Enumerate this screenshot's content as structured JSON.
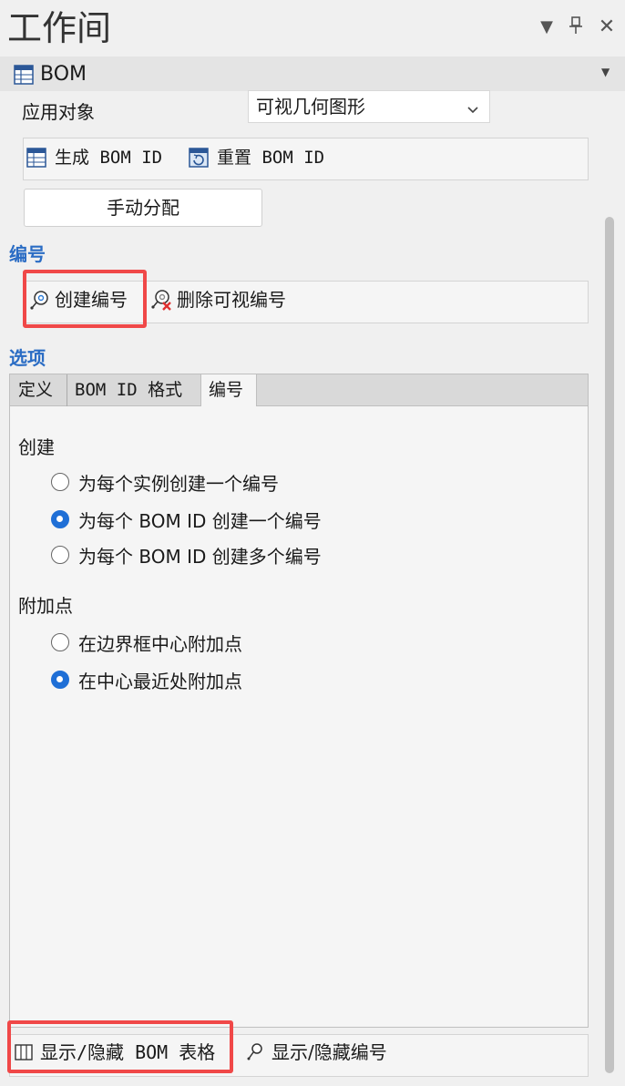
{
  "window": {
    "title": "工作间",
    "dropdown_icon": "triangle-down-icon",
    "pin_icon": "pin-icon",
    "close_icon": "close-icon"
  },
  "bom_section": {
    "label": "BOM",
    "icon": "table-icon",
    "apply_to": {
      "label": "应用对象",
      "selected": "可视几何图形"
    },
    "generate_strip": {
      "generate_label": "生成 BOM ID",
      "reset_label": "重置 BOM ID"
    },
    "manual_assign_label": "手动分配"
  },
  "numbering_section": {
    "title": "编号",
    "create_label": "创建编号",
    "delete_label": "删除可视编号"
  },
  "options_section": {
    "title": "选项",
    "tabs": [
      {
        "label": "定义",
        "active": false
      },
      {
        "label": "BOM ID 格式",
        "active": false
      },
      {
        "label": "编号",
        "active": true
      }
    ],
    "create_group": {
      "label": "创建",
      "options": [
        {
          "label": "为每个实例创建一个编号",
          "selected": false
        },
        {
          "label": "为每个 BOM ID 创建一个编号",
          "selected": true
        },
        {
          "label": "为每个 BOM ID 创建多个编号",
          "selected": false
        }
      ]
    },
    "attach_group": {
      "label": "附加点",
      "options": [
        {
          "label": "在边界框中心附加点",
          "selected": false
        },
        {
          "label": "在中心最近处附加点",
          "selected": true
        }
      ]
    }
  },
  "bottom_bar": {
    "show_hide_table_label": "显示/隐藏 BOM 表格",
    "show_hide_numbers_label": "显示/隐藏编号"
  },
  "colors": {
    "accent": "#1f6fd6",
    "section_title": "#2a6cc4",
    "highlight": "#f04848"
  }
}
